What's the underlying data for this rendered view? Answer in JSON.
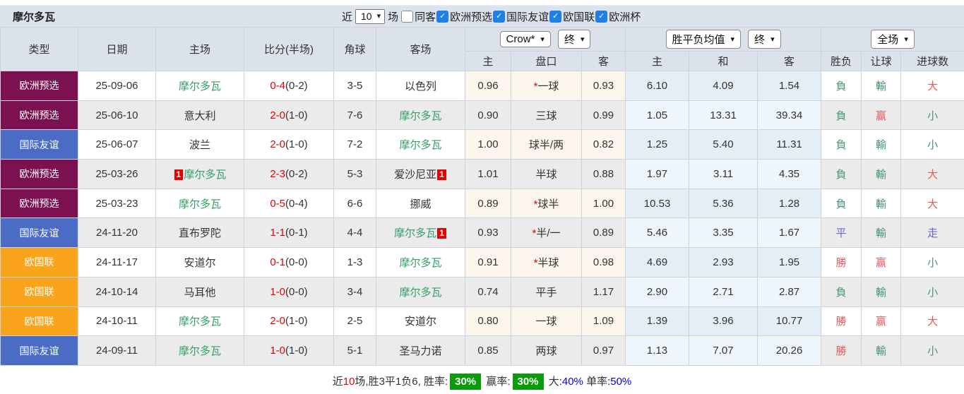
{
  "title": "摩尔多瓦",
  "topbar": {
    "recent_label": "近",
    "matches_value": "10",
    "matches_label": "场",
    "same_away": {
      "label": "同客",
      "checked": false
    },
    "leagues": [
      {
        "label": "欧洲预选",
        "checked": true
      },
      {
        "label": "国际友谊",
        "checked": true
      },
      {
        "label": "欧国联",
        "checked": true
      },
      {
        "label": "欧洲杯",
        "checked": true
      }
    ]
  },
  "header": {
    "type": "类型",
    "date": "日期",
    "home": "主场",
    "score": "比分(半场)",
    "corner": "角球",
    "away": "客场",
    "selects": {
      "odds_source": "Crow*",
      "odds_time": "终",
      "avg_source": "胜平负均值",
      "avg_time": "终",
      "scope": "全场"
    },
    "sub": {
      "crow_home": "主",
      "handicap": "盘口",
      "crow_away": "客",
      "avg_home": "主",
      "avg_draw": "和",
      "avg_away": "客",
      "result": "胜负",
      "handicap_result": "让球",
      "goals": "进球数"
    }
  },
  "type_colors": {
    "欧洲预选": "#7b1150",
    "国际友谊": "#4a6cc4",
    "欧国联": "#f9a41b"
  },
  "rows": [
    {
      "type": "欧洲预选",
      "date": "25-09-06",
      "home": {
        "name": "摩尔多瓦",
        "green": true,
        "card_pre": null,
        "card_post": null
      },
      "score": {
        "main": "0-4",
        "half": "(0-2)"
      },
      "corner": "3-5",
      "away": {
        "name": "以色列",
        "green": false,
        "card_pre": null,
        "card_post": null
      },
      "crow": {
        "home": "0.96",
        "star": true,
        "handicap": "一球",
        "away": "0.93"
      },
      "avg": {
        "home": "6.10",
        "draw": "4.09",
        "away": "1.54"
      },
      "verdict": {
        "result": {
          "t": "負",
          "c": "green"
        },
        "handicap": {
          "t": "輸",
          "c": "green"
        },
        "goals": {
          "t": "大",
          "c": "red"
        }
      }
    },
    {
      "type": "欧洲预选",
      "date": "25-06-10",
      "home": {
        "name": "意大利",
        "green": false,
        "card_pre": null,
        "card_post": null
      },
      "score": {
        "main": "2-0",
        "half": "(1-0)"
      },
      "corner": "7-6",
      "away": {
        "name": "摩尔多瓦",
        "green": true,
        "card_pre": null,
        "card_post": null
      },
      "crow": {
        "home": "0.90",
        "star": false,
        "handicap": "三球",
        "away": "0.99"
      },
      "avg": {
        "home": "1.05",
        "draw": "13.31",
        "away": "39.34"
      },
      "verdict": {
        "result": {
          "t": "負",
          "c": "green"
        },
        "handicap": {
          "t": "赢",
          "c": "red"
        },
        "goals": {
          "t": "小",
          "c": "green"
        }
      }
    },
    {
      "type": "国际友谊",
      "date": "25-06-07",
      "home": {
        "name": "波兰",
        "green": false,
        "card_pre": null,
        "card_post": null
      },
      "score": {
        "main": "2-0",
        "half": "(1-0)"
      },
      "corner": "7-2",
      "away": {
        "name": "摩尔多瓦",
        "green": true,
        "card_pre": null,
        "card_post": null
      },
      "crow": {
        "home": "1.00",
        "star": false,
        "handicap": "球半/两",
        "away": "0.82"
      },
      "avg": {
        "home": "1.25",
        "draw": "5.40",
        "away": "11.31"
      },
      "verdict": {
        "result": {
          "t": "負",
          "c": "green"
        },
        "handicap": {
          "t": "輸",
          "c": "green"
        },
        "goals": {
          "t": "小",
          "c": "green"
        }
      }
    },
    {
      "type": "欧洲预选",
      "date": "25-03-26",
      "home": {
        "name": "摩尔多瓦",
        "green": true,
        "card_pre": "1",
        "card_post": null
      },
      "score": {
        "main": "2-3",
        "half": "(0-2)"
      },
      "corner": "5-3",
      "away": {
        "name": "爱沙尼亚",
        "green": false,
        "card_pre": null,
        "card_post": "1"
      },
      "crow": {
        "home": "1.01",
        "star": false,
        "handicap": "半球",
        "away": "0.88"
      },
      "avg": {
        "home": "1.97",
        "draw": "3.11",
        "away": "4.35"
      },
      "verdict": {
        "result": {
          "t": "負",
          "c": "green"
        },
        "handicap": {
          "t": "輸",
          "c": "green"
        },
        "goals": {
          "t": "大",
          "c": "red"
        }
      }
    },
    {
      "type": "欧洲预选",
      "date": "25-03-23",
      "home": {
        "name": "摩尔多瓦",
        "green": true,
        "card_pre": null,
        "card_post": null
      },
      "score": {
        "main": "0-5",
        "half": "(0-4)"
      },
      "corner": "6-6",
      "away": {
        "name": "挪威",
        "green": false,
        "card_pre": null,
        "card_post": null
      },
      "crow": {
        "home": "0.89",
        "star": true,
        "handicap": "球半",
        "away": "1.00"
      },
      "avg": {
        "home": "10.53",
        "draw": "5.36",
        "away": "1.28"
      },
      "verdict": {
        "result": {
          "t": "負",
          "c": "green"
        },
        "handicap": {
          "t": "輸",
          "c": "green"
        },
        "goals": {
          "t": "大",
          "c": "red"
        }
      }
    },
    {
      "type": "国际友谊",
      "date": "24-11-20",
      "home": {
        "name": "直布罗陀",
        "green": false,
        "card_pre": null,
        "card_post": null
      },
      "score": {
        "main": "1-1",
        "half": "(0-1)"
      },
      "corner": "4-4",
      "away": {
        "name": "摩尔多瓦",
        "green": true,
        "card_pre": null,
        "card_post": "1"
      },
      "crow": {
        "home": "0.93",
        "star": true,
        "handicap": "半/一",
        "away": "0.89"
      },
      "avg": {
        "home": "5.46",
        "draw": "3.35",
        "away": "1.67"
      },
      "verdict": {
        "result": {
          "t": "平",
          "c": "blue"
        },
        "handicap": {
          "t": "輸",
          "c": "green"
        },
        "goals": {
          "t": "走",
          "c": "blue"
        }
      }
    },
    {
      "type": "欧国联",
      "date": "24-11-17",
      "home": {
        "name": "安道尔",
        "green": false,
        "card_pre": null,
        "card_post": null
      },
      "score": {
        "main": "0-1",
        "half": "(0-0)"
      },
      "corner": "1-3",
      "away": {
        "name": "摩尔多瓦",
        "green": true,
        "card_pre": null,
        "card_post": null
      },
      "crow": {
        "home": "0.91",
        "star": true,
        "handicap": "半球",
        "away": "0.98"
      },
      "avg": {
        "home": "4.69",
        "draw": "2.93",
        "away": "1.95"
      },
      "verdict": {
        "result": {
          "t": "勝",
          "c": "red"
        },
        "handicap": {
          "t": "赢",
          "c": "red"
        },
        "goals": {
          "t": "小",
          "c": "green"
        }
      }
    },
    {
      "type": "欧国联",
      "date": "24-10-14",
      "home": {
        "name": "马耳他",
        "green": false,
        "card_pre": null,
        "card_post": null
      },
      "score": {
        "main": "1-0",
        "half": "(0-0)"
      },
      "corner": "3-4",
      "away": {
        "name": "摩尔多瓦",
        "green": true,
        "card_pre": null,
        "card_post": null
      },
      "crow": {
        "home": "0.74",
        "star": false,
        "handicap": "平手",
        "away": "1.17"
      },
      "avg": {
        "home": "2.90",
        "draw": "2.71",
        "away": "2.87"
      },
      "verdict": {
        "result": {
          "t": "負",
          "c": "green"
        },
        "handicap": {
          "t": "輸",
          "c": "green"
        },
        "goals": {
          "t": "小",
          "c": "green"
        }
      }
    },
    {
      "type": "欧国联",
      "date": "24-10-11",
      "home": {
        "name": "摩尔多瓦",
        "green": true,
        "card_pre": null,
        "card_post": null
      },
      "score": {
        "main": "2-0",
        "half": "(1-0)"
      },
      "corner": "2-5",
      "away": {
        "name": "安道尔",
        "green": false,
        "card_pre": null,
        "card_post": null
      },
      "crow": {
        "home": "0.80",
        "star": false,
        "handicap": "一球",
        "away": "1.09"
      },
      "avg": {
        "home": "1.39",
        "draw": "3.96",
        "away": "10.77"
      },
      "verdict": {
        "result": {
          "t": "勝",
          "c": "red"
        },
        "handicap": {
          "t": "赢",
          "c": "red"
        },
        "goals": {
          "t": "大",
          "c": "red"
        }
      }
    },
    {
      "type": "国际友谊",
      "date": "24-09-11",
      "home": {
        "name": "摩尔多瓦",
        "green": true,
        "card_pre": null,
        "card_post": null
      },
      "score": {
        "main": "1-0",
        "half": "(1-0)"
      },
      "corner": "5-1",
      "away": {
        "name": "圣马力诺",
        "green": false,
        "card_pre": null,
        "card_post": null
      },
      "crow": {
        "home": "0.85",
        "star": false,
        "handicap": "两球",
        "away": "0.97"
      },
      "avg": {
        "home": "1.13",
        "draw": "7.07",
        "away": "20.26"
      },
      "verdict": {
        "result": {
          "t": "勝",
          "c": "red"
        },
        "handicap": {
          "t": "輸",
          "c": "green"
        },
        "goals": {
          "t": "小",
          "c": "green"
        }
      }
    }
  ],
  "footer": {
    "parts": [
      {
        "t": "近",
        "c": "dark"
      },
      {
        "t": "10",
        "c": "red"
      },
      {
        "t": "场,胜3平1负6, 胜率:",
        "c": "dark"
      },
      {
        "t": "30%",
        "c": "badge"
      },
      {
        "t": " 赢率:",
        "c": "dark"
      },
      {
        "t": "30%",
        "c": "badge"
      },
      {
        "t": " 大",
        "c": "dark"
      },
      {
        "t": ":40%",
        "c": "blue"
      },
      {
        "t": " 单率",
        "c": "dark"
      },
      {
        "t": ":50%",
        "c": "blue"
      }
    ]
  }
}
